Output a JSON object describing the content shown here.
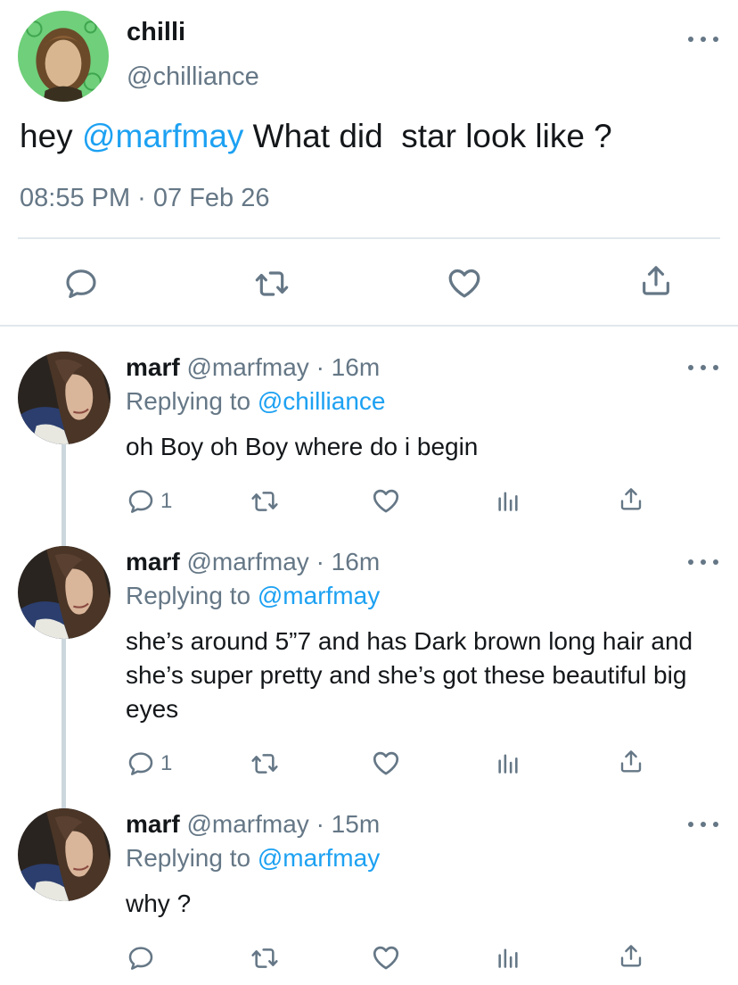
{
  "main_tweet": {
    "display_name": "chilli",
    "handle": "@chilliance",
    "text_before": "hey ",
    "mention": "@marfmay",
    "text_after": " What did  star look like ?",
    "timestamp": "08:55 PM · 07 Feb 26",
    "actions": [
      "reply-icon",
      "retweet-icon",
      "like-icon",
      "share-icon"
    ]
  },
  "replies": [
    {
      "display_name": "marf",
      "meta": " @marfmay · 16m",
      "replying_prefix": "Replying to ",
      "replying_to": "@chilliance",
      "text": "oh Boy oh Boy where do i begin",
      "reply_count": "1"
    },
    {
      "display_name": "marf",
      "meta": " @marfmay · 16m",
      "replying_prefix": "Replying to ",
      "replying_to": "@marfmay",
      "text": "she’s around 5”7 and has Dark brown long hair and she’s super pretty and she’s got these beautiful big eyes",
      "reply_count": "1"
    },
    {
      "display_name": "marf",
      "meta": " @marfmay · 15m",
      "replying_prefix": "Replying to ",
      "replying_to": "@marfmay",
      "text": "why ?",
      "reply_count": ""
    }
  ],
  "colors": {
    "link": "#1da1f2",
    "secondary_text": "#657786",
    "divider": "#e1e8ed",
    "thread_line": "#ccd6dd"
  }
}
